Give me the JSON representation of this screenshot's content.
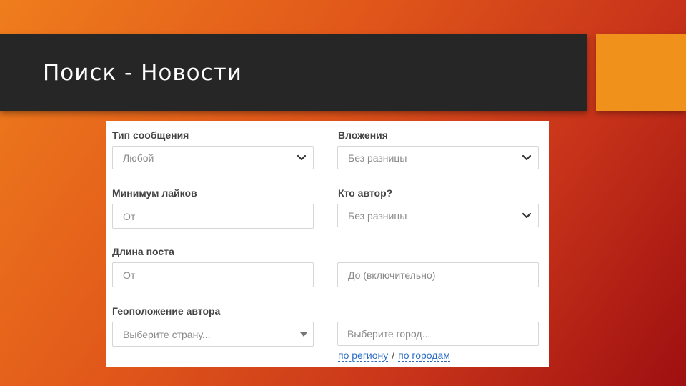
{
  "slide": {
    "title": "Поиск - Новости"
  },
  "form": {
    "message_type": {
      "label": "Тип сообщения",
      "value": "Любой"
    },
    "attachments": {
      "label": "Вложения",
      "value": "Без разницы"
    },
    "min_likes": {
      "label": "Минимум лайков",
      "placeholder": "От"
    },
    "author": {
      "label": "Кто автор?",
      "value": "Без разницы"
    },
    "post_length": {
      "label": "Длина поста",
      "from_placeholder": "От",
      "to_placeholder": "До (включительно)"
    },
    "geo": {
      "label": "Геоположение автора",
      "country_placeholder": "Выберите страну...",
      "city_placeholder": "Выберите город...",
      "by_region_link": "по региону",
      "separator": "/",
      "by_cities_link": "по городам"
    }
  },
  "colors": {
    "title_bar": "#262626",
    "accent": "#f0911b",
    "link": "#2a6cc4"
  }
}
